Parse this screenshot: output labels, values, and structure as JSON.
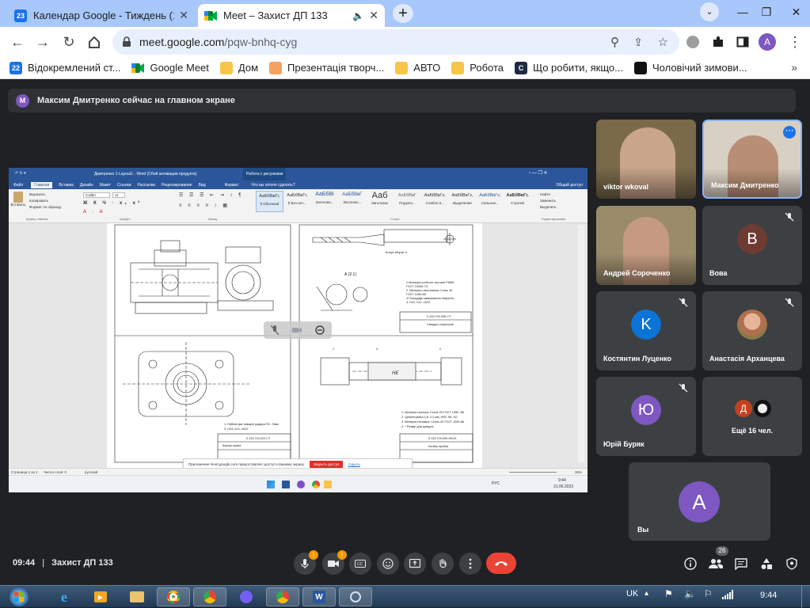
{
  "browser": {
    "tabs": [
      {
        "title": "Календар Google - Тиждень (18",
        "favicon": "23",
        "active": false
      },
      {
        "title": "Meet – Захист ДП 133",
        "active": true
      }
    ],
    "url_host": "meet.google.com",
    "url_path": "/pqw-bnhq-cyg",
    "profile_initial": "A",
    "bookmarks": [
      {
        "label": "Відокремлений ст...",
        "icon": "22"
      },
      {
        "label": "Google Meet"
      },
      {
        "label": "Дом"
      },
      {
        "label": "Презентація творч..."
      },
      {
        "label": "АВТО"
      },
      {
        "label": "Робота"
      },
      {
        "label": "Що робити, якщо..."
      },
      {
        "label": "Чоловічий зимови..."
      }
    ]
  },
  "meet": {
    "notice_initial": "M",
    "notice": "Максим Дмитренко сейчас на главном экране",
    "participants": [
      {
        "name": "viktor wkoval",
        "type": "video"
      },
      {
        "name": "Максим Дмитренко",
        "type": "video"
      },
      {
        "name": "Андрей Сороченко",
        "type": "video"
      },
      {
        "name": "Вова",
        "initial": "B",
        "color": "#6d3b32"
      },
      {
        "name": "Костянтин Луценко",
        "initial": "K",
        "color": "#0b74d6"
      },
      {
        "name": "Анастасія Арханцева",
        "type": "photo"
      },
      {
        "name": "Юрій Буряк",
        "initial": "Ю",
        "color": "#7e57c2"
      },
      {
        "name": "Ещё 16 чел.",
        "initial_a": "Д",
        "initial_b": ""
      }
    ],
    "self": {
      "name": "Вы",
      "initial": "A",
      "color": "#7e57c2"
    },
    "time": "09:44",
    "separator": "|",
    "meeting_title": "Захист ДП 133",
    "badge_mic": "!",
    "badge_cam": "!",
    "people_count": "26"
  },
  "word": {
    "title": "Дмитренко 1-Layout1 - Word (Сбой активации продукта)",
    "context_tab": "Работа с рисунками",
    "search": "Что вы хотите сделать?",
    "tabs": [
      "Файл",
      "Главная",
      "Вставка",
      "Дизайн",
      "Макет",
      "Ссылки",
      "Рассылки",
      "Рецензирование",
      "Вид",
      "Формат"
    ],
    "share": "Общий доступ",
    "paste": "Вставить",
    "clipboard": [
      "Вырезать",
      "Копировать",
      "Формат по образцу"
    ],
    "font": "Calibri",
    "size": "11",
    "styles": [
      {
        "sample": "АаБбВвГг,",
        "name": "¶ Обычный"
      },
      {
        "sample": "АаБбВвГг,",
        "name": "¶ Без инт..."
      },
      {
        "sample": "АаБбВі",
        "name": "Заголово..."
      },
      {
        "sample": "АаБбВвГ",
        "name": "Заголово..."
      },
      {
        "sample": "Ааб",
        "name": "Заголовок"
      },
      {
        "sample": "АаБбВвГ",
        "name": "Подзаго..."
      },
      {
        "sample": "АаБбВвГг,",
        "name": "Слабое в..."
      },
      {
        "sample": "АаБбВвГг,",
        "name": "Выделение"
      },
      {
        "sample": "АаБбВвГг,",
        "name": "Сильное..."
      },
      {
        "sample": "АаБбВвГг,",
        "name": "Строгий"
      }
    ],
    "edit": [
      "Найти",
      "Заменить",
      "Выделить"
    ],
    "groups": [
      "Буфер обмена",
      "Шрифт",
      "Абзац",
      "Стили",
      "Редактирование"
    ],
    "status": [
      "Страница 1 из 1",
      "Число слов: 0",
      "русский"
    ],
    "zoom": "36%",
    "lang": "РУС",
    "clock_time": "9:44",
    "clock_date": "21.06.2023",
    "share_banner": "Приложение meet.google.com предоставляет доступ к вашему экрану.",
    "share_stop": "Закрыть доступ",
    "share_hide": "Скрыть",
    "drawing_notes_left": [
      "1. Неблагоркі ливарні радіуси R2...5мм.",
      "2. H14, h14, ±t2/2"
    ],
    "drawing_stamp_left": "0.133.720.023 СТ",
    "drawing_stamp_left_name": "Корпус крана",
    "drawing_notes_top": [
      "1.Матеріал робочої частини Р6М5",
      "ГОСТ 19265-73.",
      "2. Матеріал хвостовика Сталь 40",
      "ГОСТ 1050-88.",
      "3.Площадки зварювання тверіння.",
      "4. H12, h12, ±t2/2."
    ],
    "drawing_stamp_top": "0.133.720.006 СТ",
    "drawing_stamp_top_name": "Свердло спіральне",
    "drawing_notes_br": [
      "1. Матеріал волока: Сталь 25 ГОСТ 1050 -88",
      "2. Цементувати 0,8..1,2 мм, HRC 58...62",
      "3. Матеріал вставки: Сталь 40 ГОСТ 1050-88",
      "4. * Розмір для довідок."
    ],
    "drawing_stamp_br": "0.133.720.005 ОКСК",
    "drawing_stamp_br_name": "Калібр-пробка",
    "plug_label": "НЕ",
    "detail_label": "А (2:1)",
    "detail_label_b": "Конус Морзе 3",
    "numbers": [
      "1",
      "3",
      "2"
    ]
  },
  "taskbar": {
    "lang": "UK",
    "time": "9:44"
  }
}
